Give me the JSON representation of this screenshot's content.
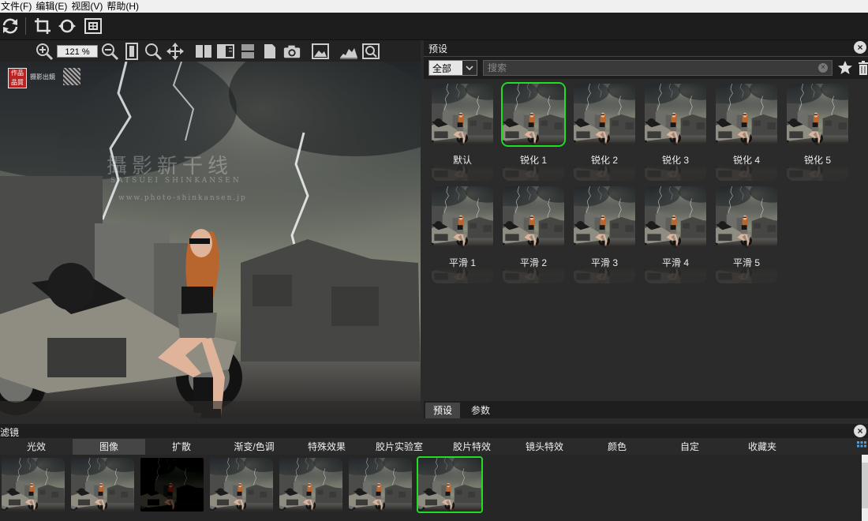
{
  "menu": [
    "文件(F)",
    "编辑(E)",
    "视图(V)",
    "帮助(H)"
  ],
  "toolbar": {
    "icons": [
      "refresh-icon",
      "crop-icon",
      "rotate-icon",
      "fit-icon"
    ]
  },
  "viewer": {
    "zoom_value": "121",
    "zoom_unit": "%",
    "badges": [
      "作品品質",
      "摄影出鏡"
    ],
    "watermark_cn": "攝影新干线",
    "watermark_en": "SATSUEI SHINKANSEN",
    "watermark_url": "www.photo-shinkansen.jp"
  },
  "presets": {
    "panel_title": "预设",
    "category_value": "全部",
    "search_placeholder": "搜索",
    "items": [
      {
        "label": "默认",
        "selected": false
      },
      {
        "label": "锐化 1",
        "selected": true
      },
      {
        "label": "锐化 2",
        "selected": false
      },
      {
        "label": "锐化 3",
        "selected": false
      },
      {
        "label": "锐化 4",
        "selected": false
      },
      {
        "label": "锐化 5",
        "selected": false
      },
      {
        "label": "平滑 1",
        "selected": false
      },
      {
        "label": "平滑 2",
        "selected": false
      },
      {
        "label": "平滑 3",
        "selected": false
      },
      {
        "label": "平滑 4",
        "selected": false
      },
      {
        "label": "平滑 5",
        "selected": false
      }
    ],
    "tabs": [
      {
        "label": "预设",
        "active": true
      },
      {
        "label": "参数",
        "active": false
      }
    ]
  },
  "filters": {
    "panel_title": "滤镜",
    "tabs": [
      {
        "label": "光效",
        "active": false
      },
      {
        "label": "图像",
        "active": true
      },
      {
        "label": "扩散",
        "active": false
      },
      {
        "label": "渐变/色调",
        "active": false
      },
      {
        "label": "特殊效果",
        "active": false
      },
      {
        "label": "胶片实验室",
        "active": false
      },
      {
        "label": "胶片特效",
        "active": false
      },
      {
        "label": "镜头特效",
        "active": false
      },
      {
        "label": "颜色",
        "active": false
      },
      {
        "label": "自定",
        "active": false
      },
      {
        "label": "收藏夹",
        "active": false
      }
    ],
    "thumbs": [
      {
        "style": "normal",
        "selected": false
      },
      {
        "style": "normal",
        "selected": false
      },
      {
        "style": "dark",
        "selected": false
      },
      {
        "style": "normal",
        "selected": false
      },
      {
        "style": "normal",
        "selected": false
      },
      {
        "style": "normal",
        "selected": false
      },
      {
        "style": "normal",
        "selected": true
      }
    ]
  },
  "colors": {
    "selection": "#22dd22",
    "panel_bg": "#2b2b2b",
    "header_bg": "#1e1e1e"
  }
}
